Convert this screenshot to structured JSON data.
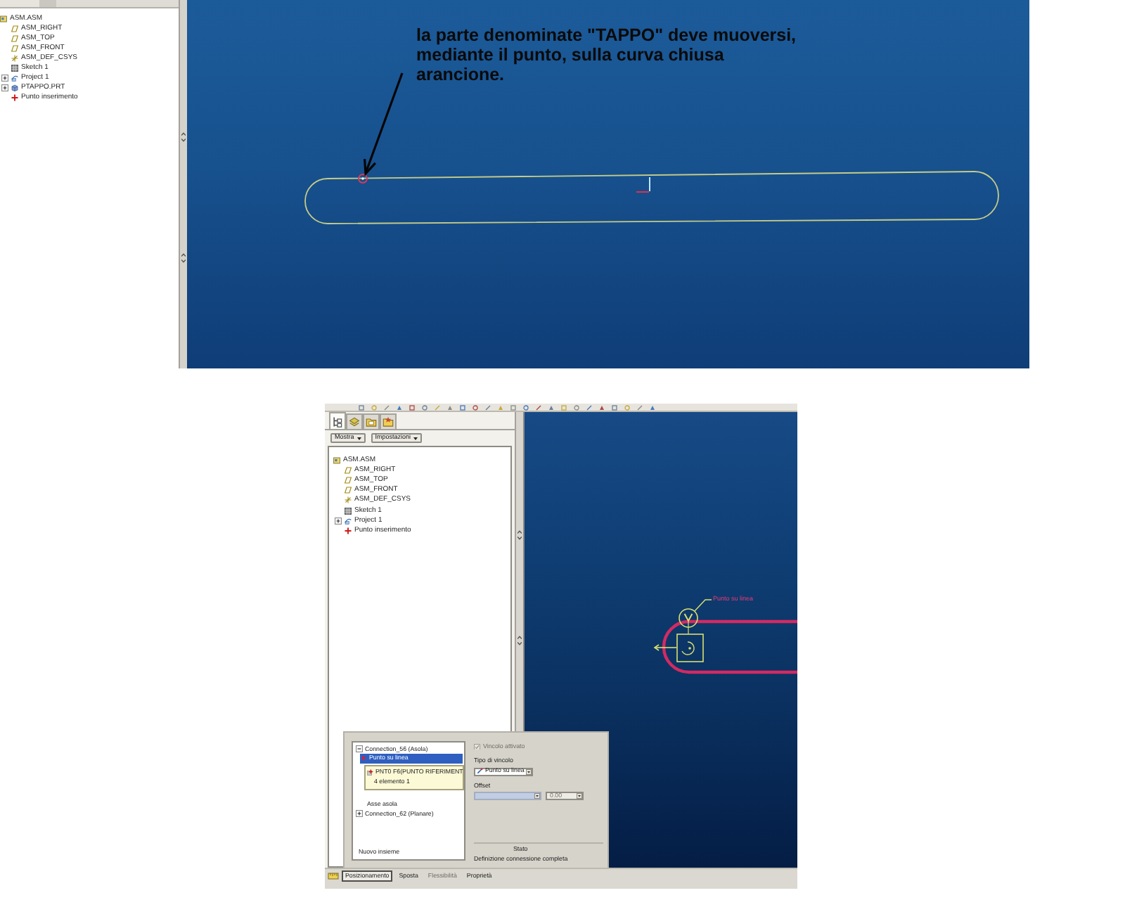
{
  "top_screenshot": {
    "model_tree": {
      "items": [
        {
          "label": "ASM.ASM",
          "kind": "assembly",
          "children": [
            {
              "label": "ASM_RIGHT",
              "kind": "plane"
            },
            {
              "label": "ASM_TOP",
              "kind": "plane"
            },
            {
              "label": "ASM_FRONT",
              "kind": "plane"
            },
            {
              "label": "ASM_DEF_CSYS",
              "kind": "csys"
            },
            {
              "label": "Sketch 1",
              "kind": "sketch"
            },
            {
              "label": "Project 1",
              "kind": "feature",
              "expanded": false
            },
            {
              "label": "PTAPPO.PRT",
              "kind": "part",
              "expanded": false
            },
            {
              "label": "Punto inserimento",
              "kind": "point"
            }
          ]
        }
      ]
    },
    "viewport": {
      "annotation": "la parte denominate \"TAPPO\" deve muoversi, mediante il punto, sulla curva chiusa arancione."
    }
  },
  "bottom_screenshot": {
    "tree_tabs": [
      {
        "kind": "tree",
        "selected": true
      },
      {
        "kind": "layers",
        "selected": false
      },
      {
        "kind": "folder",
        "selected": false
      },
      {
        "kind": "favorites",
        "selected": false
      }
    ],
    "tree_buttons": [
      {
        "label": "Mostra"
      },
      {
        "label": "Impostazioni"
      }
    ],
    "model_tree": {
      "items": [
        {
          "label": "ASM.ASM",
          "kind": "assembly",
          "children": [
            {
              "label": "ASM_RIGHT",
              "kind": "plane"
            },
            {
              "label": "ASM_TOP",
              "kind": "plane"
            },
            {
              "label": "ASM_FRONT",
              "kind": "plane"
            },
            {
              "label": "ASM_DEF_CSYS",
              "kind": "csys"
            },
            {
              "label": "Sketch 1",
              "kind": "sketch"
            },
            {
              "label": "Project 1",
              "kind": "feature",
              "expanded": false
            },
            {
              "label": "Punto inserimento",
              "kind": "point"
            }
          ]
        }
      ]
    },
    "viewport": {
      "constraint_label": "Punto su linea"
    },
    "placement_panel": {
      "connections": [
        {
          "label": "Connection_56 (Asola)",
          "expanded": true,
          "constraints": [
            {
              "label": "Punto su linea",
              "kind": "constraint",
              "selected": true,
              "references": [
                {
                  "label": "PNT0 F6(PUNTO RIFERIMENT",
                  "kind": "point"
                },
                {
                  "label": "4 elemento 1",
                  "kind": "edge"
                }
              ]
            },
            {
              "label": "Asse asola",
              "kind": "axis",
              "selected": false
            }
          ]
        },
        {
          "label": "Connection_62 (Planare)",
          "expanded": false
        }
      ],
      "new_set": "Nuovo insieme",
      "constraint_enabled": {
        "label": "Vincolo attivato",
        "checked": true,
        "disabled": true
      },
      "constraint_type": {
        "label": "Tipo di vincolo",
        "value": "Punto su linea"
      },
      "offset": {
        "label": "Offset",
        "value": "0.00",
        "disabled": true
      },
      "status": {
        "label": "Stato",
        "text": "Definizione connessione completa"
      }
    },
    "dashboard_tabs": [
      {
        "label": "Posizionamento",
        "selected": true,
        "disabled": false
      },
      {
        "label": "Sposta",
        "selected": false,
        "disabled": false
      },
      {
        "label": "Flessibilità",
        "selected": false,
        "disabled": true
      },
      {
        "label": "Proprietà",
        "selected": false,
        "disabled": false
      }
    ]
  }
}
